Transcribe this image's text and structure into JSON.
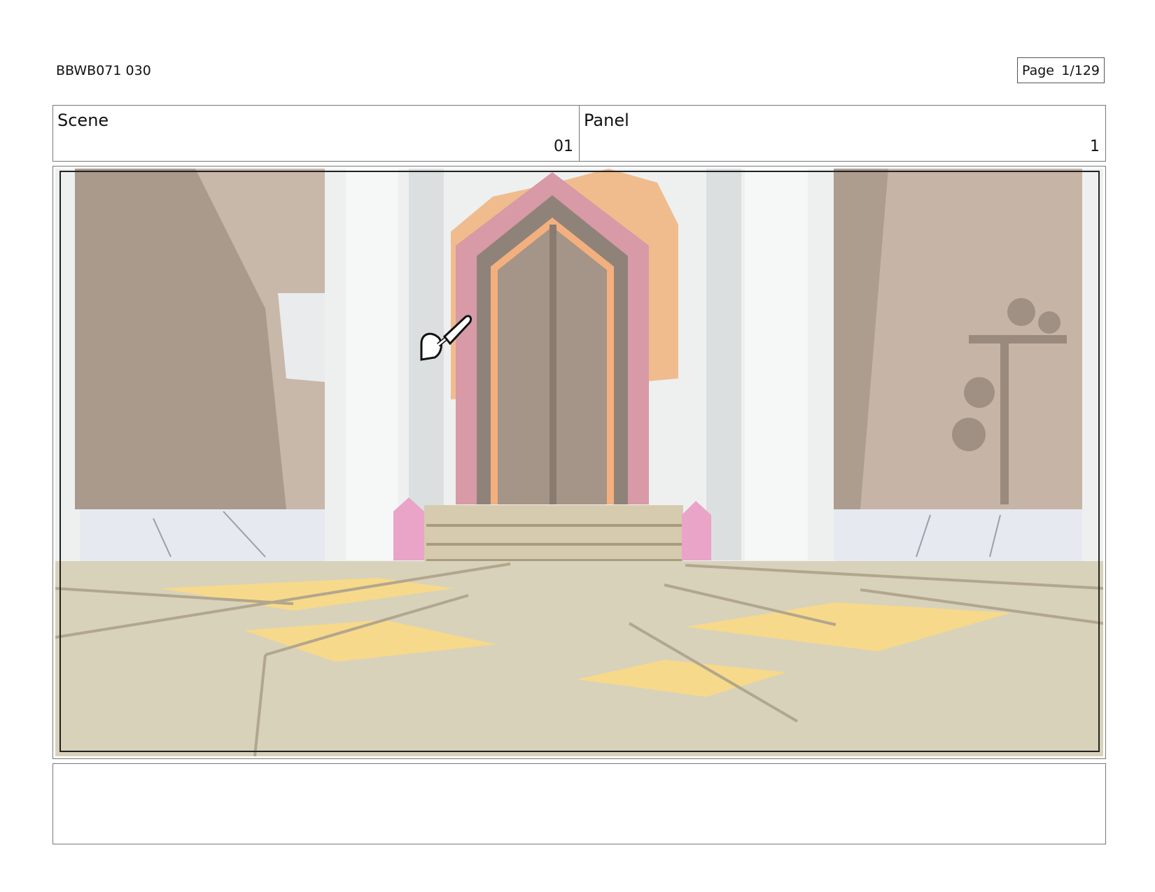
{
  "document": {
    "id": "BBWB071 030"
  },
  "page": {
    "label": "Page",
    "number": "1/129"
  },
  "scene": {
    "label": "Scene",
    "value": "01"
  },
  "panel": {
    "label": "Panel",
    "value": "1"
  },
  "artwork": {
    "subject": "castle throne room entrance with pointed doorway, pillars, pink crystals and stone floor",
    "cursor_icon": "paint-brush-cursor-icon"
  },
  "notes": {
    "text": ""
  }
}
